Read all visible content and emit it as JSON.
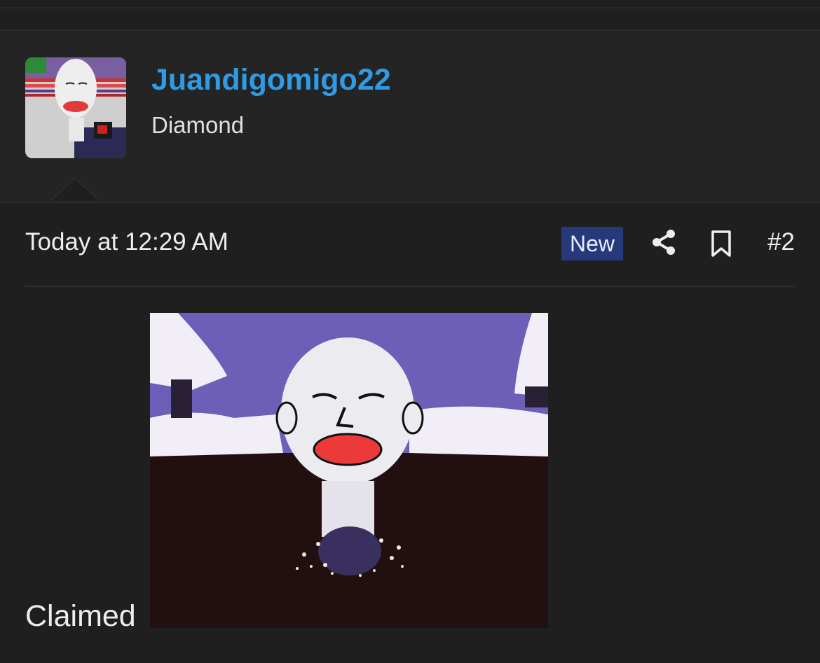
{
  "user": {
    "name": "Juandigomigo22",
    "title": "Diamond"
  },
  "post": {
    "timestamp": "Today at 12:29 AM",
    "badge": "New",
    "number": "#2",
    "body_text": "Claimed"
  },
  "icons": {
    "share": "share-icon",
    "bookmark": "bookmark-icon"
  },
  "colors": {
    "username": "#2f9be4",
    "badge_bg": "#26397a",
    "background": "#1f1f1f"
  }
}
